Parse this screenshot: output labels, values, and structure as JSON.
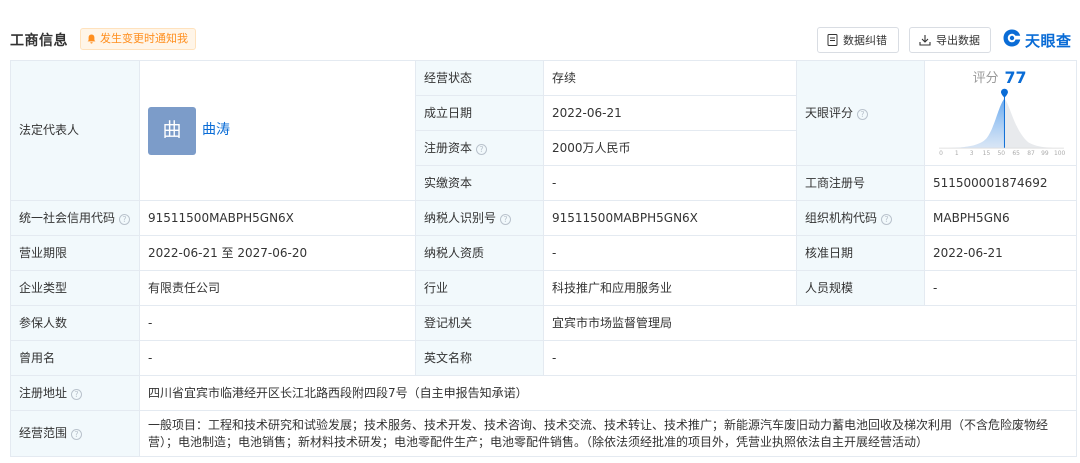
{
  "header": {
    "title": "工商信息",
    "notify_label": "发生变更时通知我",
    "correct_label": "数据纠错",
    "export_label": "导出数据",
    "brand": "天眼查"
  },
  "rows": {
    "legal_rep_label": "法定代表人",
    "avatar_char": "曲",
    "legal_rep_name": "曲涛",
    "status_label": "经营状态",
    "status_value": "存续",
    "founded_label": "成立日期",
    "founded_value": "2022-06-21",
    "score_label": "天眼评分",
    "reg_capital_label": "注册资本",
    "reg_capital_value": "2000万人民币",
    "paid_capital_label": "实缴资本",
    "paid_capital_value": "-",
    "reg_no_label": "工商注册号",
    "reg_no_value": "511500001874692",
    "credit_code_label": "统一社会信用代码",
    "credit_code_value": "91511500MABPH5GN6X",
    "taxpayer_id_label": "纳税人识别号",
    "taxpayer_id_value": "91511500MABPH5GN6X",
    "org_code_label": "组织机构代码",
    "org_code_value": "MABPH5GN6",
    "term_label": "营业期限",
    "term_value": "2022-06-21 至 2027-06-20",
    "taxpayer_qual_label": "纳税人资质",
    "taxpayer_qual_value": "-",
    "approve_date_label": "核准日期",
    "approve_date_value": "2022-06-21",
    "type_label": "企业类型",
    "type_value": "有限责任公司",
    "industry_label": "行业",
    "industry_value": "科技推广和应用服务业",
    "staff_label": "人员规模",
    "staff_value": "-",
    "insured_label": "参保人数",
    "insured_value": "-",
    "authority_label": "登记机关",
    "authority_value": "宜宾市市场监督管理局",
    "former_name_label": "曾用名",
    "former_name_value": "-",
    "english_label": "英文名称",
    "english_value": "-",
    "address_label": "注册地址",
    "address_value": "四川省宜宾市临港经开区长江北路西段附四段7号（自主申报告知承诺）",
    "scope_label": "经营范围",
    "scope_value": "一般项目：工程和技术研究和试验发展；技术服务、技术开发、技术咨询、技术交流、技术转让、技术推广；新能源汽车废旧动力蓄电池回收及梯次利用（不含危险废物经营）；电池制造；电池销售；新材料技术研发；电池零配件生产；电池零配件销售。（除依法须经批准的项目外，凭营业执照依法自主开展经营活动）"
  },
  "score": {
    "label": "评分",
    "value": 77,
    "ticks": [
      "0",
      "1",
      "3",
      "15",
      "50",
      "65",
      "87",
      "99",
      "100"
    ]
  },
  "colors": {
    "accent": "#0a6cd6",
    "label_bg": "#f2f9fc",
    "notify_text": "#ff8f1f",
    "avatar_bg": "#7c9cc9"
  },
  "icons": {
    "notify": "bell-icon",
    "correct": "document-edit-icon",
    "export": "download-icon",
    "brand": "tianyancha-logo-icon",
    "help": "question-circle-icon"
  }
}
